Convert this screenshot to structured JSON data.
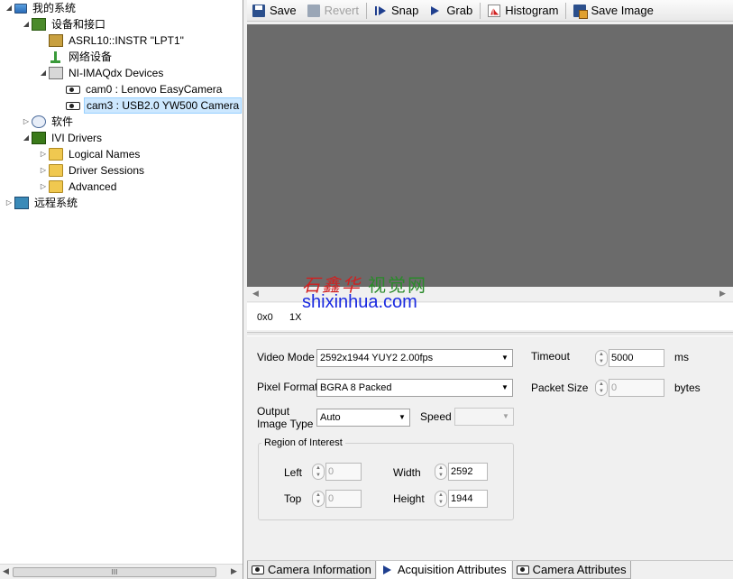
{
  "tree": {
    "items": [
      {
        "label": "我的系统",
        "icon": "computer-icon",
        "exp": "◢",
        "indent": 0
      },
      {
        "label": "设备和接口",
        "icon": "devices-icon",
        "exp": "◢",
        "indent": 1
      },
      {
        "label": "ASRL10::INSTR \"LPT1\"",
        "icon": "gpib-icon",
        "exp": "",
        "indent": 2
      },
      {
        "label": "网络设备",
        "icon": "network-icon",
        "exp": "",
        "indent": 2
      },
      {
        "label": "NI-IMAQdx Devices",
        "icon": "imaq-icon",
        "exp": "◢",
        "indent": 2
      },
      {
        "label": "cam0 : Lenovo EasyCamera",
        "icon": "camera-icon",
        "exp": "",
        "indent": 3
      },
      {
        "label": "cam3 : USB2.0 YW500 Camera",
        "icon": "camera-icon",
        "exp": "",
        "indent": 3,
        "selected": true
      },
      {
        "label": "软件",
        "icon": "software-icon",
        "exp": "▷",
        "indent": 1
      },
      {
        "label": "IVI Drivers",
        "icon": "ivi-icon",
        "exp": "◢",
        "indent": 1
      },
      {
        "label": "Logical Names",
        "icon": "folder-ivi-icon",
        "exp": "▷",
        "indent": 2
      },
      {
        "label": "Driver Sessions",
        "icon": "folder-sessions-icon",
        "exp": "▷",
        "indent": 2
      },
      {
        "label": "Advanced",
        "icon": "folder-icon",
        "exp": "▷",
        "indent": 2
      },
      {
        "label": "远程系统",
        "icon": "remote-icon",
        "exp": "▷",
        "indent": 0
      }
    ],
    "scroll_thumb": "III"
  },
  "toolbar": {
    "save": "Save",
    "revert": "Revert",
    "snap": "Snap",
    "grab": "Grab",
    "histogram": "Histogram",
    "save_image": "Save Image"
  },
  "viewer": {
    "coords": "0x0",
    "zoom": "1X",
    "background": "#6b6b6b"
  },
  "watermark": {
    "chinese_red": "石鑫华",
    "chinese_green": "视觉网",
    "url": "shixinhua.com"
  },
  "settings": {
    "video_mode_label": "Video Mode",
    "video_mode_value": "2592x1944 YUY2 2.00fps",
    "pixel_format_label": "Pixel Format",
    "pixel_format_value": "BGRA 8 Packed",
    "output_image_type_label_1": "Output",
    "output_image_type_label_2": "Image Type",
    "output_image_type_value": "Auto",
    "speed_label": "Speed",
    "speed_value": "",
    "timeout_label": "Timeout",
    "timeout_value": "5000",
    "timeout_unit": "ms",
    "packet_size_label": "Packet Size",
    "packet_size_value": "0",
    "packet_size_unit": "bytes",
    "roi": {
      "title": "Region of Interest",
      "left_label": "Left",
      "left_value": "0",
      "top_label": "Top",
      "top_value": "0",
      "width_label": "Width",
      "width_value": "2592",
      "height_label": "Height",
      "height_value": "1944"
    }
  },
  "tabs": [
    {
      "label": "Camera Information",
      "active": false
    },
    {
      "label": "Acquisition Attributes",
      "active": true
    },
    {
      "label": "Camera Attributes",
      "active": false
    }
  ]
}
